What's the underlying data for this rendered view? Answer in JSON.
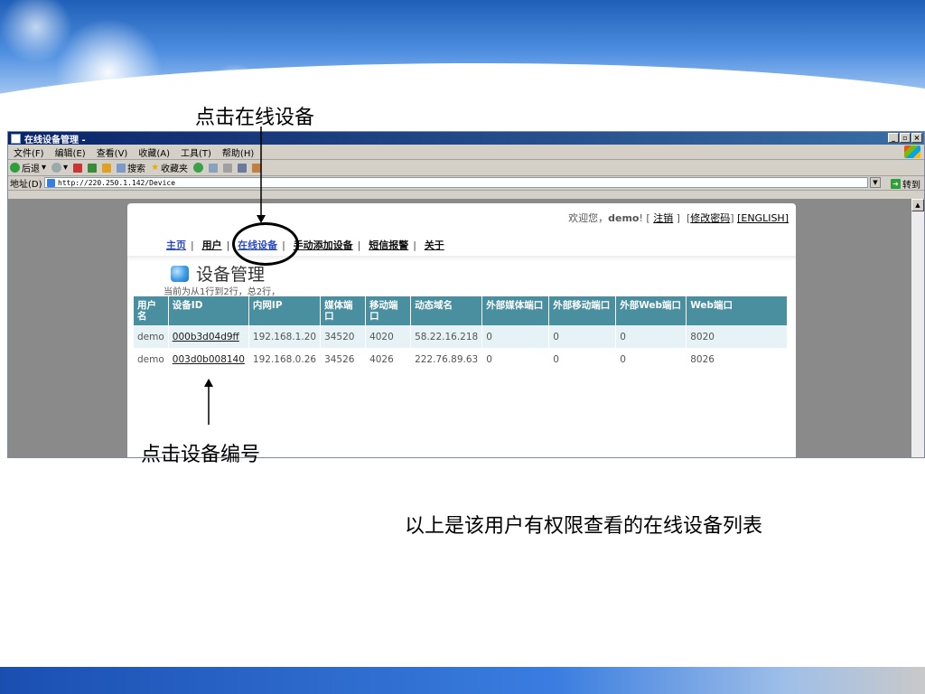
{
  "slide": {
    "callout_online": "点击在线设备",
    "callout_device_id": "点击设备编号",
    "caption": "以上是该用户有权限查看的在线设备列表"
  },
  "browser": {
    "title": "在线设备管理 -",
    "menu": [
      "文件(F)",
      "编辑(E)",
      "查看(V)",
      "收藏(A)",
      "工具(T)",
      "帮助(H)"
    ],
    "toolbar": {
      "back": "后退",
      "search": "搜索",
      "favorites": "收藏夹"
    },
    "address_label": "地址(D)",
    "address_value": "http://220.250.1.142/Device",
    "go_label": "转到",
    "window_buttons": [
      "_",
      "▫",
      "×"
    ]
  },
  "page": {
    "welcome_prefix": "欢迎您，",
    "user": "demo",
    "welcome_suffix": "! [",
    "logout": "注销",
    "close_bracket": " ]",
    "change_password": "修改密码",
    "english": "[ENGLISH]",
    "nav": [
      "主页",
      "用户",
      "在线设备",
      "手动添加设备",
      "短信报警",
      "关于"
    ],
    "title": "设备管理",
    "row_info": "当前为从1行到2行，总2行，"
  },
  "table": {
    "headers": [
      "用户名",
      "设备ID",
      "内网IP",
      "媒体端口",
      "移动端口",
      "动态域名",
      "外部媒体端口",
      "外部移动端口",
      "外部Web端口",
      "Web端口"
    ],
    "rows": [
      [
        "demo",
        "000b3d04d9ff",
        "192.168.1.20",
        "34520",
        "4020",
        "58.22.16.218",
        "0",
        "0",
        "0",
        "8020"
      ],
      [
        "demo",
        "003d0b008140",
        "192.168.0.26",
        "34526",
        "4026",
        "222.76.89.63",
        "0",
        "0",
        "0",
        "8026"
      ]
    ]
  },
  "colors": {
    "header_bg": "#4a8fa0",
    "row_alt": "#e7f2f7",
    "titlebar": "#0a246a"
  }
}
